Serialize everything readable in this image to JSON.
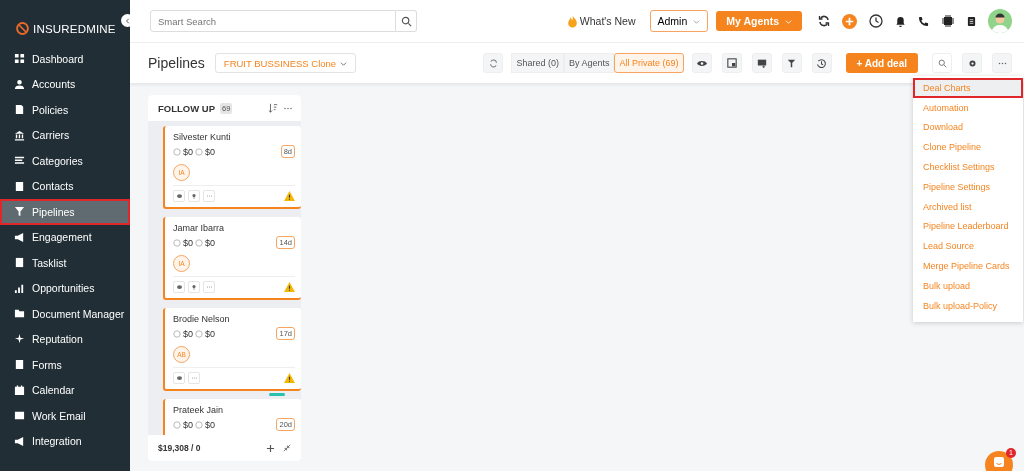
{
  "sidebar": {
    "logo": "**INSURED**MINE",
    "items": [
      {
        "label": "Dashboard",
        "selected": false
      },
      {
        "label": "Accounts",
        "selected": false
      },
      {
        "label": "Policies",
        "selected": false
      },
      {
        "label": "Carriers",
        "selected": false
      },
      {
        "label": "Categories",
        "selected": false
      },
      {
        "label": "Contacts",
        "selected": false
      },
      {
        "label": "Pipelines",
        "selected": true
      },
      {
        "label": "Engagement",
        "selected": false
      },
      {
        "label": "Tasklist",
        "selected": false
      },
      {
        "label": "Opportunities",
        "selected": false
      },
      {
        "label": "Document Manager",
        "selected": false
      },
      {
        "label": "Reputation",
        "selected": false
      },
      {
        "label": "Forms",
        "selected": false
      },
      {
        "label": "Calendar",
        "selected": false
      },
      {
        "label": "Work Email",
        "selected": false
      },
      {
        "label": "Integration",
        "selected": false
      }
    ]
  },
  "topbar": {
    "search": {
      "placeholder": "Smart Search"
    },
    "whats_new": "What's New",
    "role": "Admin",
    "agents_button": "My Agents"
  },
  "header": {
    "title": "Pipelines",
    "pipeline": "FRUIT BUSSINESS Clone",
    "filters": [
      {
        "label": "Shared (0)",
        "selected": false
      },
      {
        "label": "By Agents",
        "selected": false
      },
      {
        "label": "All Private (69)",
        "selected": true
      }
    ],
    "add_button": "+ Add deal"
  },
  "column": {
    "title": "FOLLOW UP",
    "count": "69",
    "total": "$19,308 / 0",
    "cards": [
      {
        "name": "Silvester Kunti",
        "amount_1": "$0",
        "amount_2": "$0",
        "age": "8d",
        "avatar": "IA",
        "pin": true,
        "warning": true
      },
      {
        "name": "Jamar Ibarra",
        "amount_1": "$0",
        "amount_2": "$0",
        "age": "14d",
        "avatar": "IA",
        "pin": true,
        "warning": true
      },
      {
        "name": "Brodie Nelson",
        "amount_1": "$0",
        "amount_2": "$0",
        "age": "17d",
        "avatar": "AB",
        "pin": false,
        "warning": true
      },
      {
        "name": "Prateek Jain",
        "amount_1": "$0",
        "amount_2": "$0",
        "age": "20d"
      }
    ]
  },
  "menu": {
    "items": [
      {
        "label": "Deal Charts",
        "selected": true
      },
      {
        "label": "Automation",
        "selected": false
      },
      {
        "label": "Download",
        "selected": false
      },
      {
        "label": "Clone Pipeline",
        "selected": false
      },
      {
        "label": "Checklist Settings",
        "selected": false
      },
      {
        "label": "Pipeline Settings",
        "selected": false
      },
      {
        "label": "Archived list",
        "selected": false
      },
      {
        "label": "Pipeline Leaderboard",
        "selected": false
      },
      {
        "label": "Lead Source",
        "selected": false
      },
      {
        "label": "Merge Pipeline Cards",
        "selected": false
      },
      {
        "label": "Bulk upload",
        "selected": false
      },
      {
        "label": "Bulk upload-Policy",
        "selected": false
      }
    ]
  },
  "chat": {
    "badge": "1"
  }
}
